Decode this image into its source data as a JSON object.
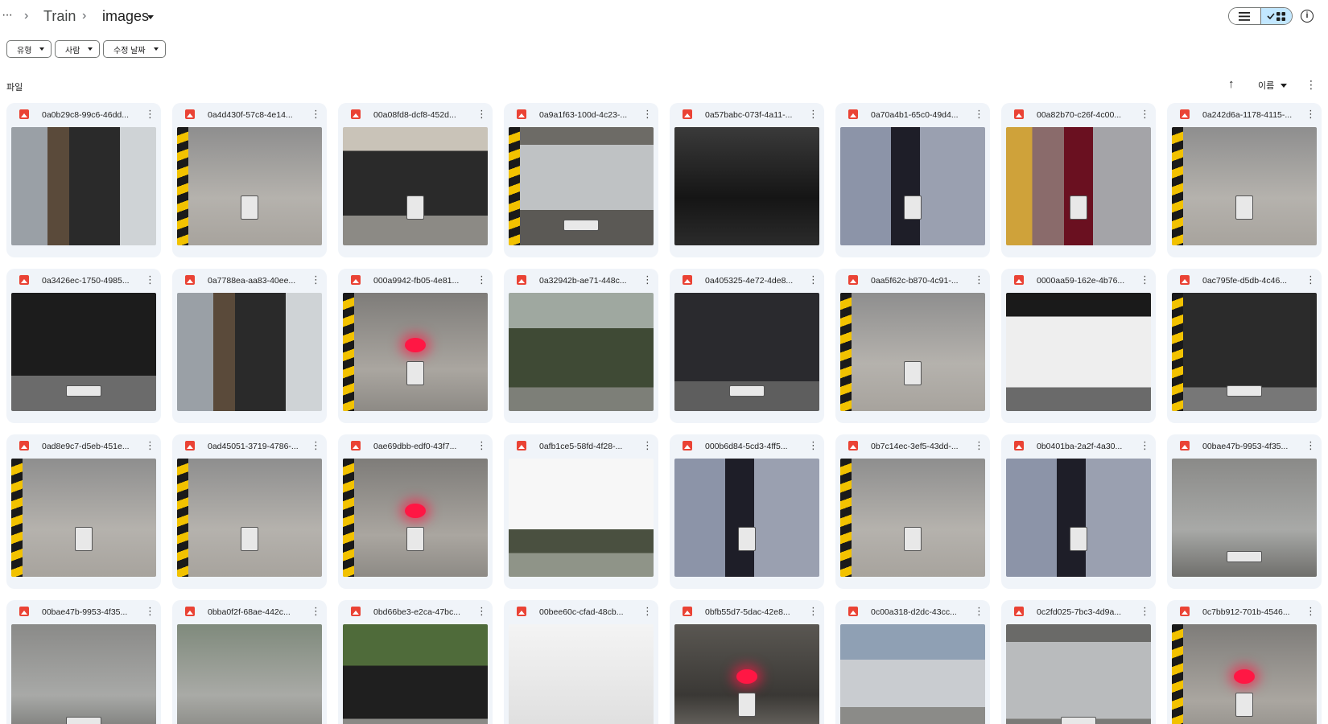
{
  "breadcrumb": {
    "more_label": "···",
    "separator": "›",
    "items": [
      "Train",
      "images"
    ]
  },
  "filters": [
    {
      "label": "유형"
    },
    {
      "label": "사람"
    },
    {
      "label": "수정 날짜"
    }
  ],
  "section": {
    "label": "파일",
    "sort_label": "이름",
    "sort_arrow": "↑",
    "more": "⋮"
  },
  "colors": {
    "card_bg": "#f0f4f9",
    "toggle_active": "#c2e7ff",
    "image_file_icon": "#ea4335"
  },
  "files": [
    {
      "name": "0a0b29c8-99c6-46dd...",
      "thumb": "car-barrier-dark"
    },
    {
      "name": "0a4d430f-57c8-4e14...",
      "thumb": "motorbike-plate"
    },
    {
      "name": "00a08fd8-dcf8-452d...",
      "thumb": "black-sportscar-street"
    },
    {
      "name": "0a9a1f63-100d-4c23-...",
      "thumb": "silver-car-barrier"
    },
    {
      "name": "0a57babc-073f-4a11-...",
      "thumb": "dark-car-barrier"
    },
    {
      "name": "0a70a4b1-65c0-49d4...",
      "thumb": "motorbike-distorted"
    },
    {
      "name": "00a82b70-c26f-4c00...",
      "thumb": "motorbike-red"
    },
    {
      "name": "0a242d6a-1178-4115-...",
      "thumb": "motorbike-plate"
    },
    {
      "name": "0a3426ec-1750-4985...",
      "thumb": "black-sedan-front"
    },
    {
      "name": "0a7788ea-aa83-40ee...",
      "thumb": "car-barrier-dark"
    },
    {
      "name": "000a9942-fb05-4e81...",
      "thumb": "motorbike-taillight"
    },
    {
      "name": "0a32942b-ae71-448c...",
      "thumb": "military-truck"
    },
    {
      "name": "0a405325-4e72-4de8...",
      "thumb": "black-suv-front"
    },
    {
      "name": "0aa5f62c-b870-4c91-...",
      "thumb": "motorbike-plate"
    },
    {
      "name": "0000aa59-162e-4b76...",
      "thumb": "white-car-barrier"
    },
    {
      "name": "0ac795fe-d5db-4c46...",
      "thumb": "dark-suv-plate"
    },
    {
      "name": "0ad8e9c7-d5eb-451e...",
      "thumb": "motorbike-plate"
    },
    {
      "name": "0ad45051-3719-4786-...",
      "thumb": "motorbike-plate"
    },
    {
      "name": "0ae69dbb-edf0-43f7...",
      "thumb": "motorbike-taillight"
    },
    {
      "name": "0afb1ce5-58fd-4f28-...",
      "thumb": "truck-field-bright"
    },
    {
      "name": "000b6d84-5cd3-4ff5...",
      "thumb": "motorbike-distorted"
    },
    {
      "name": "0b7c14ec-3ef5-43dd-...",
      "thumb": "motorbike-plate"
    },
    {
      "name": "0b0401ba-2a2f-4a30...",
      "thumb": "motorbike-distorted"
    },
    {
      "name": "00bae47b-9953-4f35...",
      "thumb": "silver-hatchback"
    },
    {
      "name": "00bae47b-9953-4f35...",
      "thumb": "silver-hatchback"
    },
    {
      "name": "0bba0f2f-68ae-442c...",
      "thumb": "silver-car-top"
    },
    {
      "name": "0bd66be3-e2ca-47bc...",
      "thumb": "black-bmw-street"
    },
    {
      "name": "00bee60c-cfad-48cb...",
      "thumb": "white-car-emblem"
    },
    {
      "name": "0bfb55d7-5dac-42e8...",
      "thumb": "motorbike-rear"
    },
    {
      "name": "0c00a318-d2dc-43cc...",
      "thumb": "parking-sign-street"
    },
    {
      "name": "0c2fd025-7bc3-4d9a...",
      "thumb": "silver-van-front"
    },
    {
      "name": "0c7bb912-701b-4546...",
      "thumb": "motorbike-taillight"
    }
  ]
}
